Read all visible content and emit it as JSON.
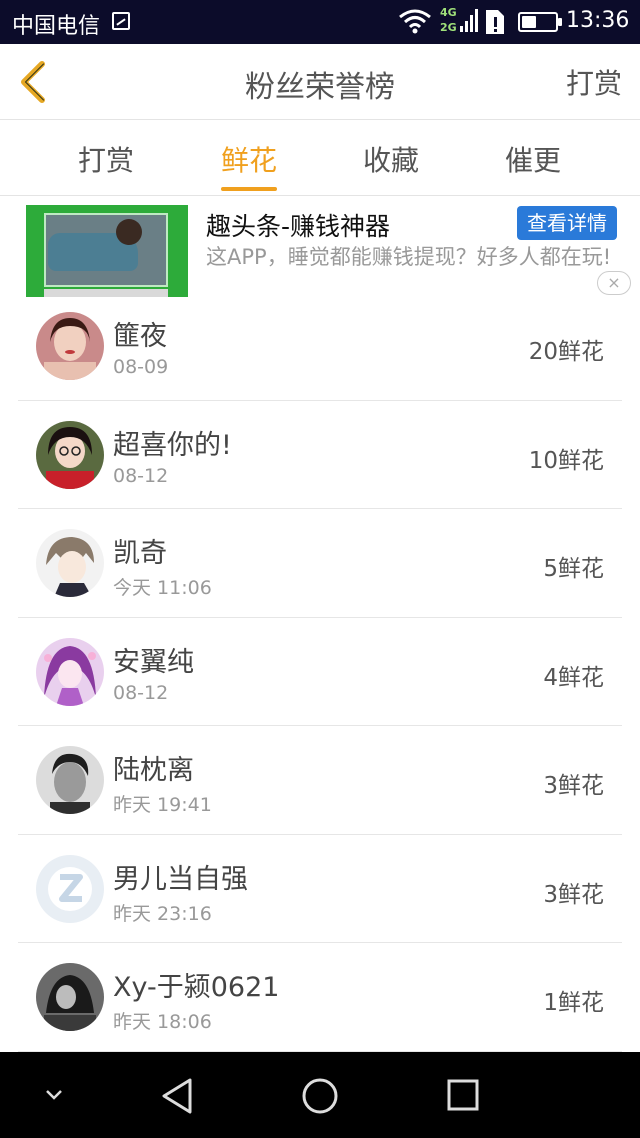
{
  "status_bar": {
    "carrier": "中国电信",
    "net_4g": "4G",
    "net_2g": "2G",
    "time": "13:36",
    "battery_level": 0.45,
    "icons": [
      "sim-status-icon",
      "wifi-icon",
      "signal-icon",
      "sim-card-alert-icon",
      "battery-icon"
    ]
  },
  "header": {
    "title": "粉丝荣誉榜",
    "right_link": "打赏",
    "back_icon": "chevron-left-icon"
  },
  "tabs": [
    {
      "label": "打赏",
      "active": false
    },
    {
      "label": "鲜花",
      "active": true
    },
    {
      "label": "收藏",
      "active": false
    },
    {
      "label": "催更",
      "active": false
    }
  ],
  "ad": {
    "title": "趣头条-赚钱神器",
    "button": "查看详情",
    "description": "这APP，睡觉都能赚钱提现？好多人都在玩!",
    "close_icon": "×"
  },
  "fans": [
    {
      "name": "篚夜",
      "time": "08-09",
      "amount": "20鲜花"
    },
    {
      "name": "超喜你的!",
      "time": "08-12",
      "amount": "10鲜花"
    },
    {
      "name": "凯奇",
      "time": "今天 11:06",
      "amount": "5鲜花"
    },
    {
      "name": "安翼纯",
      "time": "08-12",
      "amount": "4鲜花"
    },
    {
      "name": "陆枕离",
      "time": "昨天 19:41",
      "amount": "3鲜花"
    },
    {
      "name": "男儿当自强",
      "time": "昨天 23:16",
      "amount": "3鲜花"
    },
    {
      "name": "Xy-于颍0621",
      "time": "昨天 18:06",
      "amount": "1鲜花"
    }
  ],
  "nav_bar": {
    "icons": [
      "collapse-chevron-icon",
      "back-triangle-icon",
      "home-circle-icon",
      "recents-square-icon"
    ]
  },
  "colors": {
    "accent": "#f0a01e",
    "status_bar": "#0c0c2a",
    "ad_button": "#2a7ad9"
  }
}
